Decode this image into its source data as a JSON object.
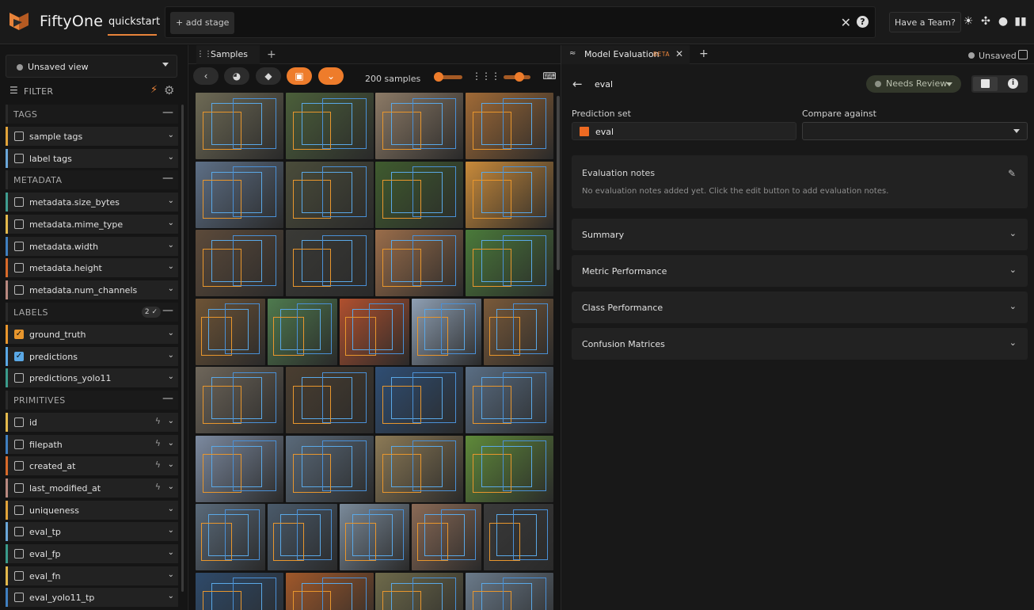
{
  "header": {
    "brand": "FiftyOne",
    "dataset": "quickstart",
    "add_stage": "+ add stage",
    "team_button": "Have a Team?",
    "accent_color": "#e8833a"
  },
  "sidebar": {
    "view_select": "Unsaved view",
    "filter_label": "FILTER",
    "sections": [
      {
        "title": "TAGS",
        "items": [
          {
            "label": "sample tags",
            "color": "#e0a33a",
            "checked": false,
            "bolt": false
          },
          {
            "label": "label tags",
            "color": "#6aa6d8",
            "checked": false,
            "bolt": false
          }
        ]
      },
      {
        "title": "METADATA",
        "items": [
          {
            "label": "metadata.size_bytes",
            "color": "#3f9c8f",
            "checked": false,
            "bolt": false
          },
          {
            "label": "metadata.mime_type",
            "color": "#e3b94c",
            "checked": false,
            "bolt": false
          },
          {
            "label": "metadata.width",
            "color": "#3f7fbf",
            "checked": false,
            "bolt": false
          },
          {
            "label": "metadata.height",
            "color": "#d86a2a",
            "checked": false,
            "bolt": false
          },
          {
            "label": "metadata.num_channels",
            "color": "#b8887f",
            "checked": false,
            "bolt": false
          }
        ]
      },
      {
        "title": "LABELS",
        "badge": "2 ✓",
        "items": [
          {
            "label": "ground_truth",
            "color": "#e8962d",
            "checked": true,
            "bolt": false
          },
          {
            "label": "predictions",
            "color": "#5aa8e6",
            "checked": true,
            "bolt": false
          },
          {
            "label": "predictions_yolo11",
            "color": "#3a9a8a",
            "checked": false,
            "bolt": false
          }
        ]
      },
      {
        "title": "PRIMITIVES",
        "items": [
          {
            "label": "id",
            "color": "#e3b94c",
            "checked": false,
            "bolt": true
          },
          {
            "label": "filepath",
            "color": "#3f7fbf",
            "checked": false,
            "bolt": true
          },
          {
            "label": "created_at",
            "color": "#d86a2a",
            "checked": false,
            "bolt": true
          },
          {
            "label": "last_modified_at",
            "color": "#b8887f",
            "checked": false,
            "bolt": true
          },
          {
            "label": "uniqueness",
            "color": "#e0a33a",
            "checked": false,
            "bolt": false
          },
          {
            "label": "eval_tp",
            "color": "#6aa6d8",
            "checked": false,
            "bolt": false
          },
          {
            "label": "eval_fp",
            "color": "#3a9a8a",
            "checked": false,
            "bolt": false
          },
          {
            "label": "eval_fn",
            "color": "#e3b94c",
            "checked": false,
            "bolt": false
          },
          {
            "label": "eval_yolo11_tp",
            "color": "#3f7fbf",
            "checked": false,
            "bolt": false
          }
        ]
      }
    ]
  },
  "samples": {
    "tab_label": "Samples",
    "count_label": "200 samples",
    "tiles": [
      [
        "#6e6a55",
        "#4b5f3a",
        "#8c7a66",
        "#a06a36"
      ],
      [
        "#5d6f86",
        "#4a4c3a",
        "#3f5b2e",
        "#c88a3a"
      ],
      [
        "#5c4a3a",
        "#3a3a36",
        "#9a6d4a",
        "#4a7a3a"
      ],
      [
        "#6e5436",
        "#4e7a4e",
        "#b0502e",
        "#8fa0b4",
        "#7a5a3a"
      ],
      [
        "#6e665a",
        "#4a3e30",
        "#2f4e74",
        "#5a6e84"
      ],
      [
        "#7c8aa0",
        "#5a6a7a",
        "#8c7a56",
        "#5f8a3a"
      ],
      [
        "#5a6a7a",
        "#4a5a6a",
        "#7a8a9a",
        "#8a6a56",
        "#3a3a3a"
      ],
      [
        "#2e4a6a",
        "#a0582a",
        "#6e6a4a",
        "#6a7a8a"
      ]
    ]
  },
  "panel": {
    "tab_label": "Model Evaluation",
    "tab_badge": "BETA",
    "unsaved": "Unsaved",
    "eval_name": "eval",
    "review_status": "Needs Review",
    "prediction_set_label": "Prediction set",
    "prediction_value": "eval",
    "prediction_color": "#ee6a22",
    "compare_label": "Compare against",
    "compare_value": "",
    "notes_title": "Evaluation notes",
    "notes_body": "No evaluation notes added yet. Click the edit button to add evaluation notes.",
    "sections": [
      "Summary",
      "Metric Performance",
      "Class Performance",
      "Confusion Matrices"
    ]
  }
}
